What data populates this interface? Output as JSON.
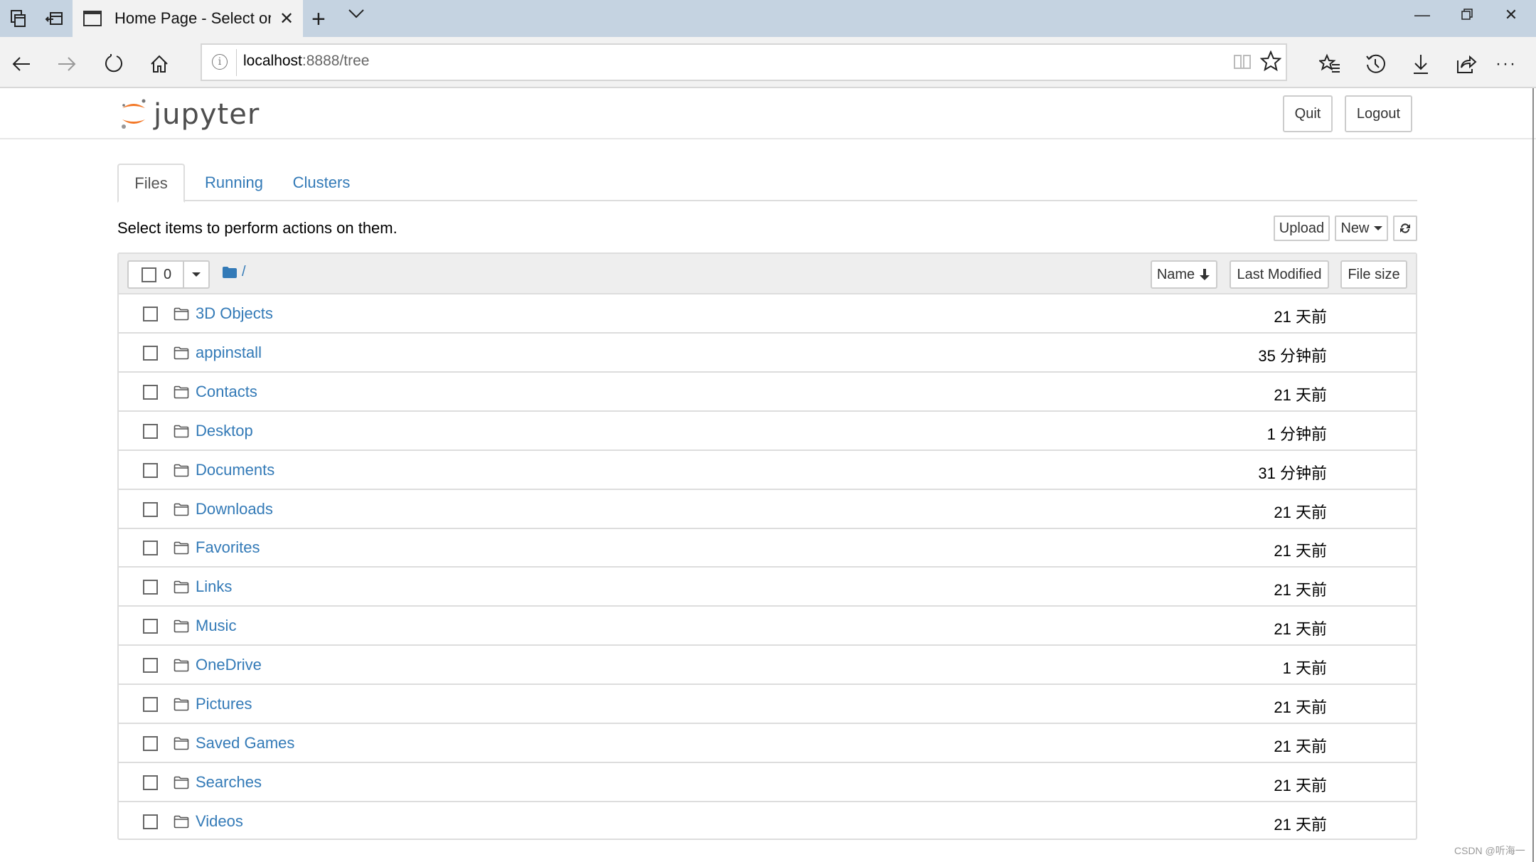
{
  "browser": {
    "tab_title": "Home Page - Select or c",
    "url_host": "localhost",
    "url_rest": ":8888/tree"
  },
  "header": {
    "logo_text": "jupyter",
    "quit_label": "Quit",
    "logout_label": "Logout"
  },
  "tabs": [
    {
      "label": "Files",
      "active": true
    },
    {
      "label": "Running",
      "active": false
    },
    {
      "label": "Clusters",
      "active": false
    }
  ],
  "toolbar": {
    "hint": "Select items to perform actions on them.",
    "upload_label": "Upload",
    "new_label": "New"
  },
  "list": {
    "selected_count": "0",
    "breadcrumb": "/",
    "columns": {
      "name": "Name",
      "last_modified": "Last Modified",
      "file_size": "File size"
    },
    "items": [
      {
        "name": "3D Objects",
        "modified": "21 天前"
      },
      {
        "name": "appinstall",
        "modified": "35 分钟前"
      },
      {
        "name": "Contacts",
        "modified": "21 天前"
      },
      {
        "name": "Desktop",
        "modified": "1 分钟前"
      },
      {
        "name": "Documents",
        "modified": "31 分钟前"
      },
      {
        "name": "Downloads",
        "modified": "21 天前"
      },
      {
        "name": "Favorites",
        "modified": "21 天前"
      },
      {
        "name": "Links",
        "modified": "21 天前"
      },
      {
        "name": "Music",
        "modified": "21 天前"
      },
      {
        "name": "OneDrive",
        "modified": "1 天前"
      },
      {
        "name": "Pictures",
        "modified": "21 天前"
      },
      {
        "name": "Saved Games",
        "modified": "21 天前"
      },
      {
        "name": "Searches",
        "modified": "21 天前"
      },
      {
        "name": "Videos",
        "modified": "21 天前"
      }
    ]
  },
  "watermark": "CSDN @听海一",
  "colors": {
    "link": "#337ab7",
    "logo_orange": "#f37726",
    "titlebar": "#c5d3e1"
  }
}
